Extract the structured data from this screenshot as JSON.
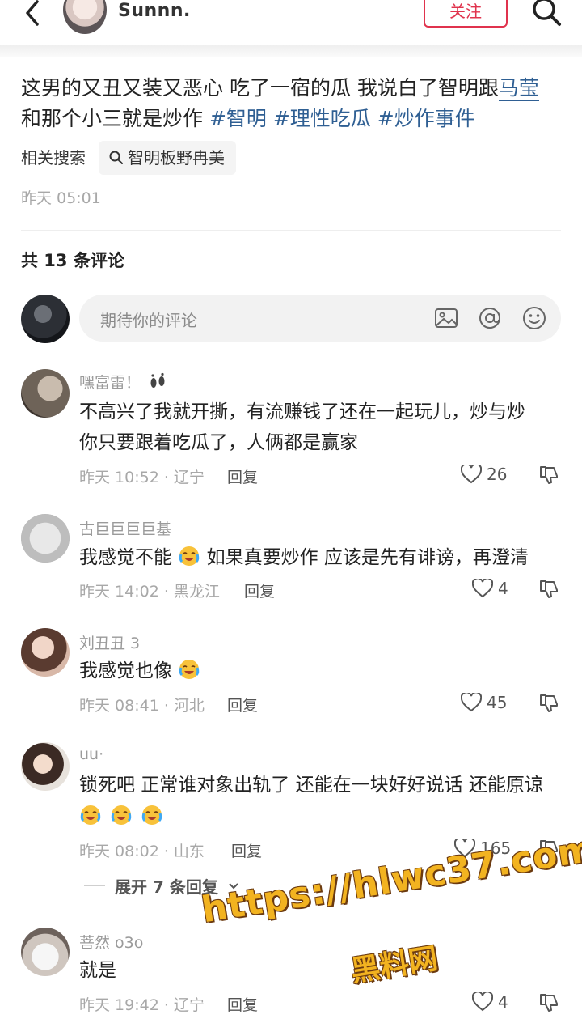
{
  "header": {
    "author": "Sunnn.",
    "follow_label": "关注"
  },
  "post": {
    "text_plain": "这男的又丑又装又恶心 吃了一宿的瓜 我说白了智明跟",
    "text_link": "马莹",
    "text_line2": "和那个小三就是炒作 ",
    "tags": [
      "#智明",
      "#理性吃瓜",
      "#炒作事件"
    ],
    "related_label": "相关搜索",
    "related_query": "智明板野冉美",
    "time": "昨天 05:01"
  },
  "comments_header": {
    "count_label": "共 13 条评论"
  },
  "comment_input": {
    "placeholder": "期待你的评论",
    "icons": [
      "image-icon",
      "at-icon",
      "emoji-icon"
    ]
  },
  "comments": [
    {
      "user": "嘿富雷！",
      "text_line1": "不高兴了我就开撕，有流赚钱了还在一起玩儿，炒与炒",
      "text_line2": "你只要跟着吃瓜了，人俩都是赢家",
      "time_location": "昨天 10:52 · 辽宁",
      "reply": "回复",
      "likes": "26"
    },
    {
      "user": "古巨巨巨巨基",
      "text_a": "我感觉不能",
      "text_b": "如果真要炒作 应该是先有诽谤，再澄清",
      "time_location": "昨天 14:02 · 黑龙江",
      "reply": "回复",
      "likes": "4"
    },
    {
      "user": "刘丑丑 3",
      "text_a": "我感觉也像",
      "time_location": "昨天 08:41 · 河北",
      "reply": "回复",
      "likes": "45"
    },
    {
      "user": "uu·",
      "text_line1": "锁死吧 正常谁对象出轨了 还能在一块好好说话 还能原谅",
      "time_location": "昨天 08:02 · 山东",
      "reply": "回复",
      "likes": "165",
      "expand_label": "展开 7 条回复"
    },
    {
      "user": "菩然 o3o",
      "text_line1": "就是",
      "time_location": "昨天 19:42 · 辽宁",
      "reply": "回复",
      "likes": "4"
    }
  ],
  "watermark": {
    "line1": "https://hlwc37.com",
    "line2": "黑料网"
  },
  "colors": {
    "accent_red": "#e0334d",
    "tag_blue": "#2f5f93",
    "meta_gray": "#a8a8a8"
  }
}
